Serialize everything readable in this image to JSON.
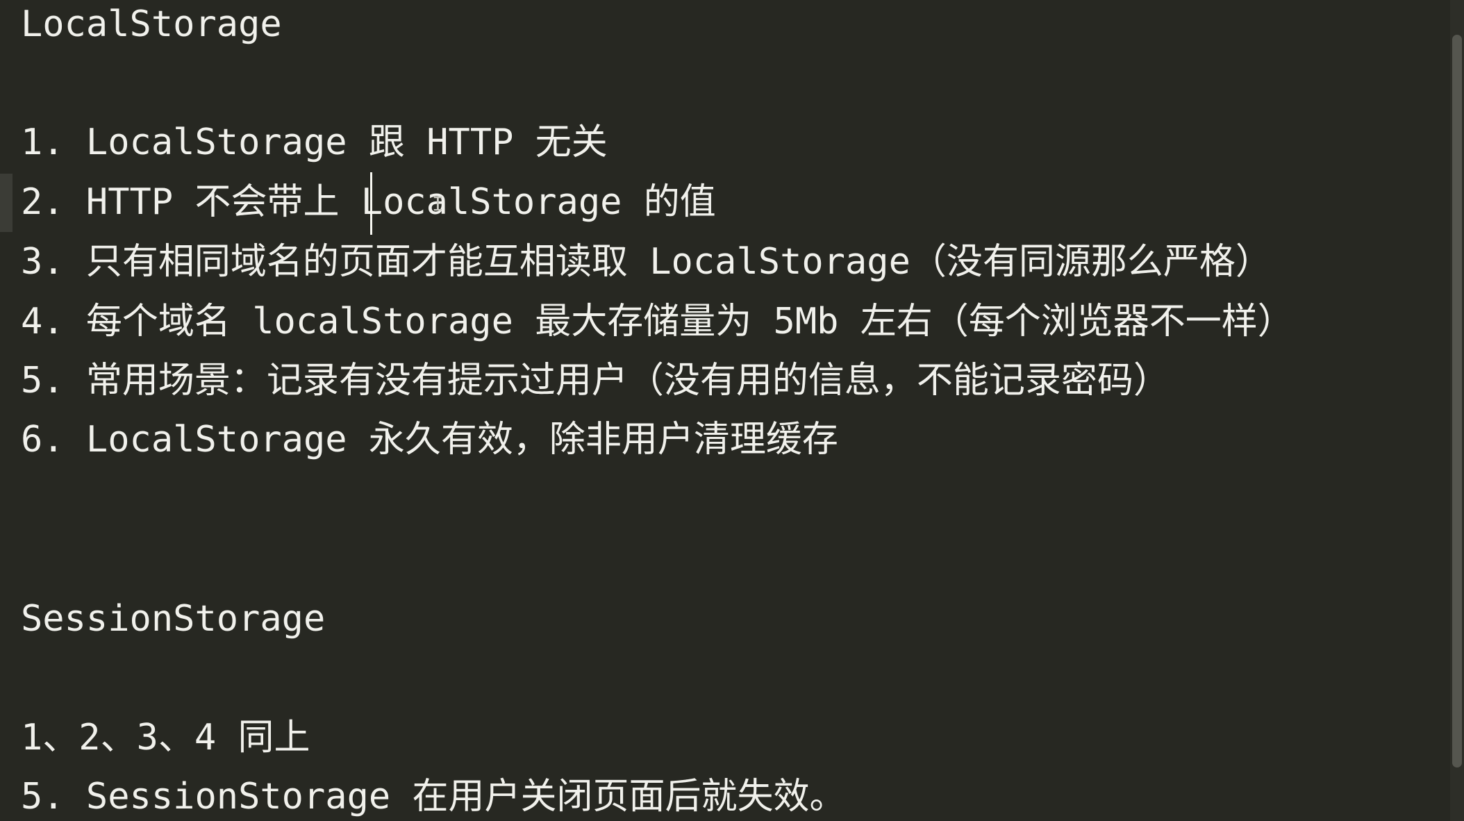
{
  "document": {
    "lines": [
      "LocalStorage",
      "1. LocalStorage 跟 HTTP 无关",
      "2. HTTP 不会带上 LocalStorage 的值",
      "3. 只有相同域名的页面才能互相读取 LocalStorage（没有同源那么严格）",
      "4. 每个域名 localStorage 最大存储量为 5Mb 左右（每个浏览器不一样）",
      "5. 常用场景：记录有没有提示过用户（没有用的信息，不能记录密码）",
      "6. LocalStorage 永久有效，除非用户清理缓存",
      "SessionStorage",
      "1、2、3、4 同上",
      "5. SessionStorage 在用户关闭页面后就失效。"
    ]
  },
  "theme": {
    "background": "#272822",
    "text": "#f1f1ec",
    "scrollbar": "#55564f"
  }
}
